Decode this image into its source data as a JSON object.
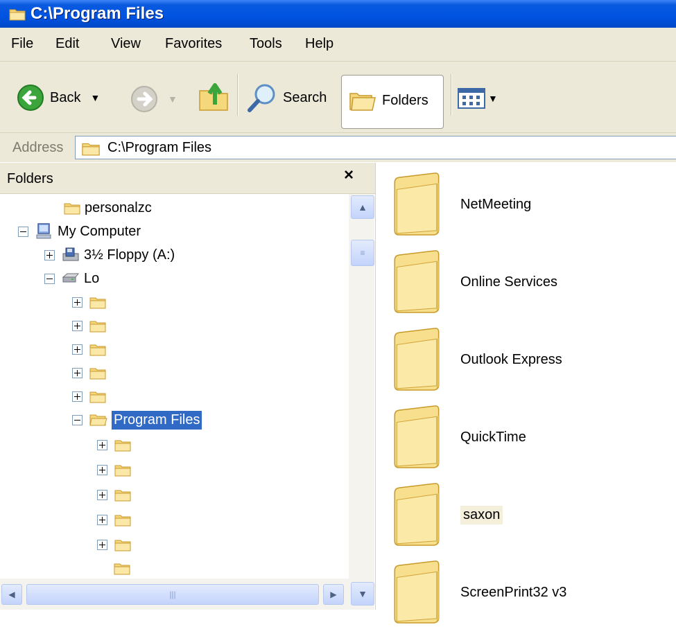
{
  "window": {
    "title": "C:\\Program Files"
  },
  "menu": [
    "File",
    "Edit",
    "View",
    "Favorites",
    "Tools",
    "Help"
  ],
  "toolbar": {
    "back_label": "Back",
    "search_label": "Search",
    "folders_label": "Folders"
  },
  "address": {
    "label": "Address",
    "value": "C:\\Program Files"
  },
  "left_pane": {
    "header": "Folders",
    "close_glyph": "×",
    "tree": [
      {
        "label": "personalzc",
        "icon": "folder-icon"
      },
      {
        "label": "My Computer",
        "icon": "computer-icon",
        "expander": "minus"
      },
      {
        "label": "3½ Floppy (A:)",
        "icon": "floppy-icon",
        "expander": "plus"
      },
      {
        "label": "Lo",
        "icon": "drive-icon",
        "expander": "minus"
      },
      {
        "label": "",
        "expander": "plus"
      },
      {
        "label": "",
        "expander": "plus"
      },
      {
        "label": "",
        "expander": "plus"
      },
      {
        "label": "",
        "expander": "plus"
      },
      {
        "label": "",
        "expander": "plus"
      },
      {
        "label": "Program Files",
        "expander": "minus",
        "selected": true
      },
      {
        "label": "",
        "expander": "plus"
      },
      {
        "label": "",
        "expander": "plus"
      },
      {
        "label": "",
        "expander": "plus"
      },
      {
        "label": "",
        "expander": "plus"
      },
      {
        "label": "",
        "expander": "plus"
      },
      {
        "label": ""
      },
      {
        "label": "",
        "expander": "plus"
      }
    ]
  },
  "right_pane": {
    "items": [
      "NetMeeting",
      "Online Services",
      "Outlook Express",
      "QuickTime",
      "saxon",
      "ScreenPrint32 v3"
    ]
  },
  "colors": {
    "title_bar": "#0053e1",
    "chrome": "#ece9d8",
    "selection": "#316ac5",
    "folder": "#f6d97a"
  }
}
